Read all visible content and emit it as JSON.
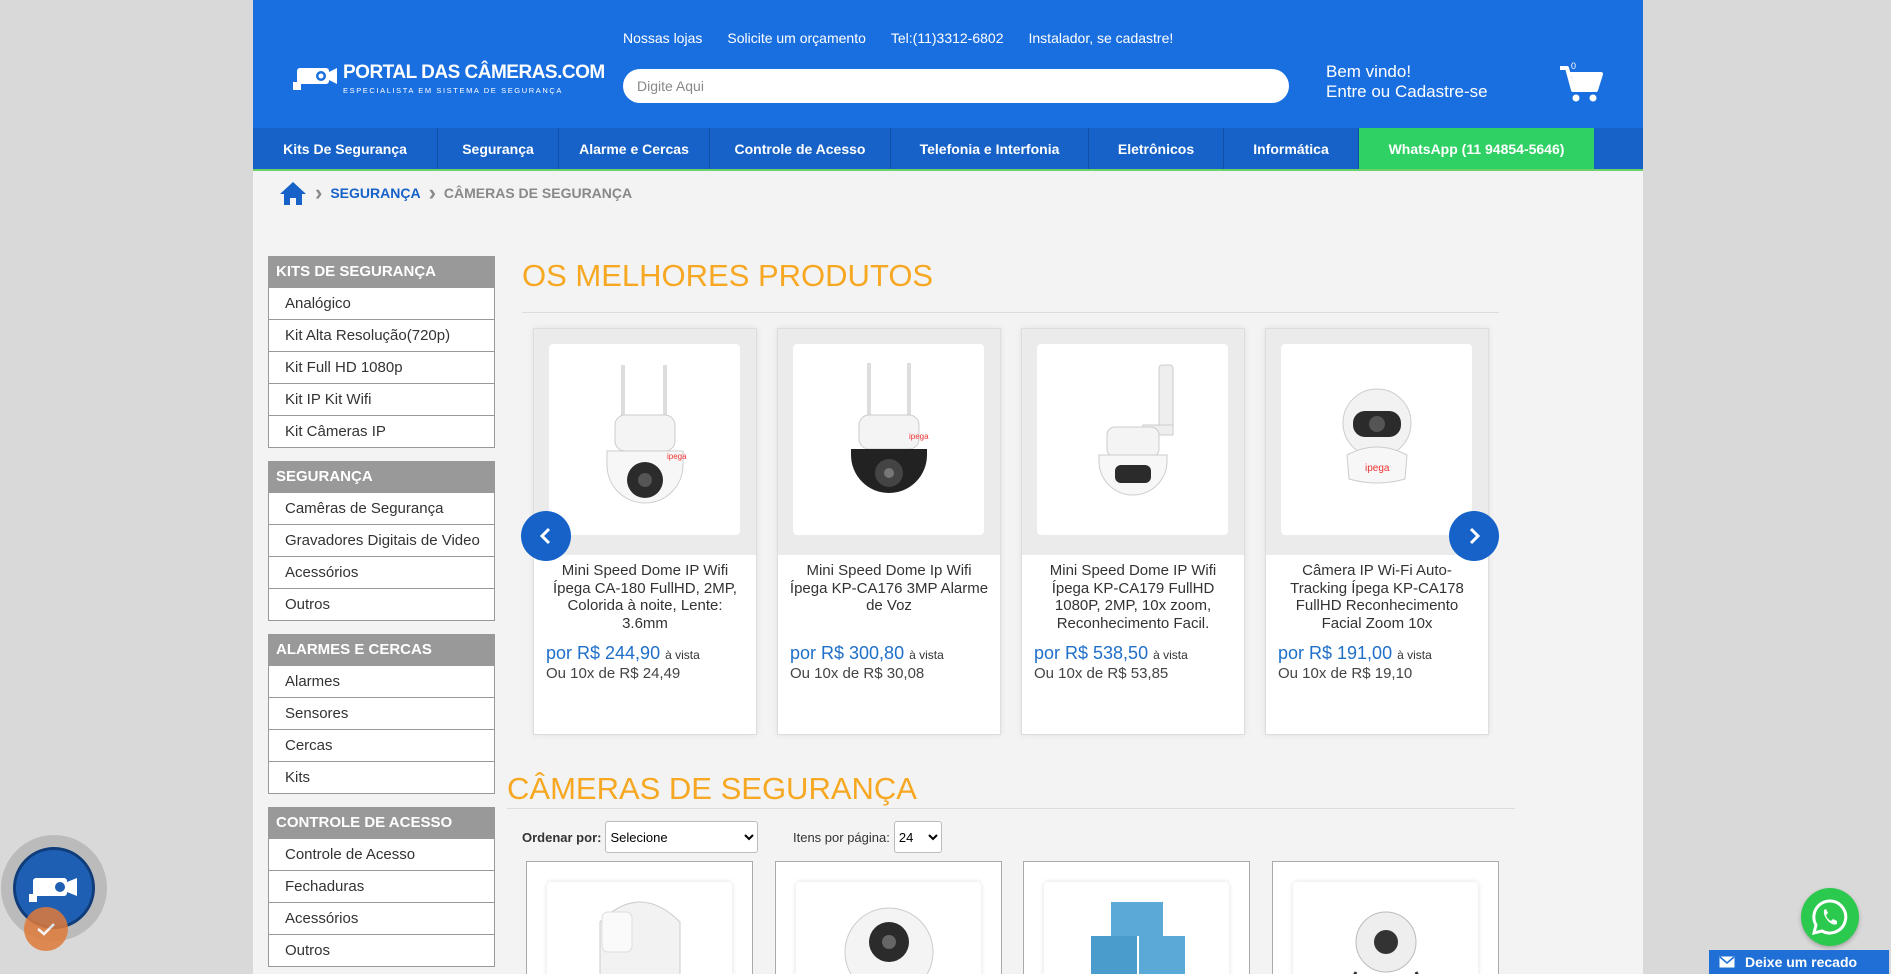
{
  "header": {
    "logo_title": "PORTAL DAS CÂMERAS.COM",
    "logo_subtitle": "ESPECIALISTA EM SISTEMA DE SEGURANÇA",
    "top_links": [
      "Nossas lojas",
      "Solicite um orçamento",
      "Tel:(11)3312-6802",
      "Instalador, se cadastre!"
    ],
    "search_placeholder": "Digite Aqui",
    "welcome_line1": "Bem vindo!",
    "welcome_line2": "Entre ou Cadastre-se",
    "cart_count": "0"
  },
  "nav": [
    "Kits De Segurança",
    "Segurança",
    "Alarme e Cercas",
    "Controle de Acesso",
    "Telefonia e Interfonia",
    "Eletrônicos",
    "Informática",
    "WhatsApp (11 94854-5646)"
  ],
  "breadcrumb": {
    "level1": "SEGURANÇA",
    "level2": "CÂMERAS DE SEGURANÇA"
  },
  "sidebar": [
    {
      "title": "KITS DE SEGURANÇA",
      "items": [
        "Analógico",
        "Kit Alta Resolução(720p)",
        "Kit Full HD 1080p",
        "Kit IP Kit Wifi",
        "Kit Câmeras IP"
      ]
    },
    {
      "title": "SEGURANÇA",
      "items": [
        "Camêras de Segurança",
        "Gravadores Digitais de Video",
        "Acessórios",
        "Outros"
      ]
    },
    {
      "title": "ALARMES E CERCAS",
      "items": [
        "Alarmes",
        "Sensores",
        "Cercas",
        "Kits"
      ]
    },
    {
      "title": "CONTROLE DE ACESSO",
      "items": [
        "Controle de Acesso",
        "Fechaduras",
        "Acessórios",
        "Outros"
      ]
    }
  ],
  "best": {
    "title": "OS MELHORES PRODUTOS",
    "products": [
      {
        "name": "Mini Speed Dome IP Wifi Ípega CA-180 FullHD, 2MP, Colorida à noite, Lente: 3.6mm",
        "price": "por R$ 244,90",
        "price_suffix": "à vista",
        "installments": "Ou 10x de R$ 24,49"
      },
      {
        "name": "Mini Speed Dome Ip Wifi Ípega KP-CA176 3MP Alarme de Voz",
        "price": "por R$ 300,80",
        "price_suffix": "à vista",
        "installments": "Ou 10x de R$ 30,08"
      },
      {
        "name": "Mini Speed Dome IP Wifi Ípega KP-CA179 FullHD 1080P, 2MP, 10x zoom, Reconhecimento Facil.",
        "price": "por R$ 538,50",
        "price_suffix": "à vista",
        "installments": "Ou 10x de R$ 53,85"
      },
      {
        "name": "Câmera IP Wi-Fi Auto-Tracking Ípega KP-CA178 FullHD Reconhecimento Facial Zoom 10x",
        "price": "por R$ 191,00",
        "price_suffix": "à vista",
        "installments": "Ou 10x de R$ 19,10"
      }
    ]
  },
  "category": {
    "title": "CÂMERAS DE SEGURANÇA",
    "sort_label": "Ordenar por:",
    "sort_value": "Selecione",
    "per_page_label": "Itens por página:",
    "per_page_value": "24"
  },
  "widgets": {
    "recado": "Deixe um recado"
  },
  "colors": {
    "primary": "#1a6fe0",
    "accent": "#f7a823",
    "whatsapp": "#2fd164",
    "price": "#1f6fc9"
  }
}
